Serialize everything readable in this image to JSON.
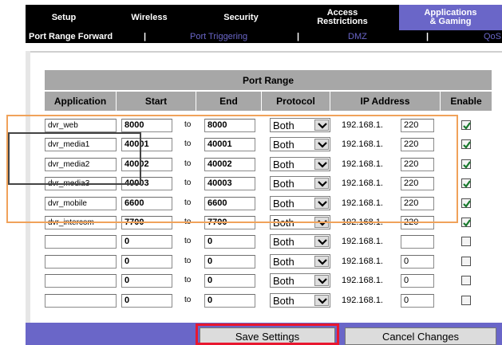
{
  "nav": {
    "tabs": [
      {
        "label": "Setup"
      },
      {
        "label": "Wireless"
      },
      {
        "label": "Security"
      },
      {
        "label_line1": "Access",
        "label_line2": "Restrictions"
      },
      {
        "label_line1": "Applications",
        "label_line2": "& Gaming"
      }
    ],
    "subtabs": {
      "port_range_forward": "Port Range Forward",
      "port_triggering": "Port Triggering",
      "dmz": "DMZ",
      "qos": "QoS",
      "separator": "|"
    }
  },
  "table": {
    "title": "Port Range",
    "headers": {
      "application": "Application",
      "start": "Start",
      "end": "End",
      "protocol": "Protocol",
      "ip_address": "IP Address",
      "enable": "Enable"
    },
    "to_label": "to",
    "ip_prefix": "192.168.1.",
    "rows": [
      {
        "application": "dvr_web",
        "start": "8000",
        "end": "8000",
        "protocol": "Both",
        "ip": "220",
        "enabled": true
      },
      {
        "application": "dvr_media1",
        "start": "40001",
        "end": "40001",
        "protocol": "Both",
        "ip": "220",
        "enabled": true
      },
      {
        "application": "dvr_media2",
        "start": "40002",
        "end": "40002",
        "protocol": "Both",
        "ip": "220",
        "enabled": true
      },
      {
        "application": "dvr_media3",
        "start": "40003",
        "end": "40003",
        "protocol": "Both",
        "ip": "220",
        "enabled": true
      },
      {
        "application": "dvr_mobile",
        "start": "6600",
        "end": "6600",
        "protocol": "Both",
        "ip": "220",
        "enabled": true
      },
      {
        "application": "dvr_intercom",
        "start": "7700",
        "end": "7700",
        "protocol": "Both",
        "ip": "220",
        "enabled": true
      },
      {
        "application": "",
        "start": "0",
        "end": "0",
        "protocol": "Both",
        "ip": "",
        "enabled": false
      },
      {
        "application": "",
        "start": "0",
        "end": "0",
        "protocol": "Both",
        "ip": "0",
        "enabled": false
      },
      {
        "application": "",
        "start": "0",
        "end": "0",
        "protocol": "Both",
        "ip": "0",
        "enabled": false
      },
      {
        "application": "",
        "start": "0",
        "end": "0",
        "protocol": "Both",
        "ip": "0",
        "enabled": false
      }
    ]
  },
  "buttons": {
    "save": "Save Settings",
    "cancel": "Cancel Changes"
  },
  "colors": {
    "accent": "#6a66c8",
    "header_bg": "#a7a7a7",
    "highlight_orange": "#f0a25a",
    "highlight_red": "#e8172f"
  }
}
